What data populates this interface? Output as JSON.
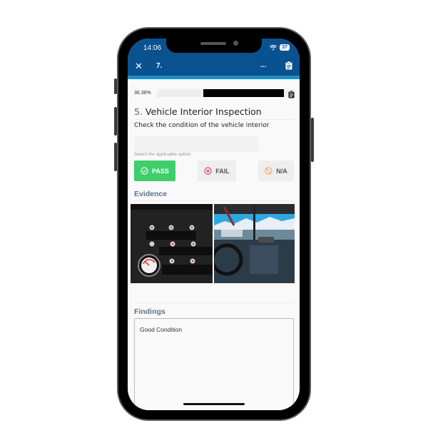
{
  "status_bar": {
    "time": "14:06",
    "battery": "37",
    "wifi_icon": "wifi-icon"
  },
  "header": {
    "close_label": "✕",
    "title": "7.",
    "more_label": "...",
    "clipboard_icon": "clipboard-icon"
  },
  "progress": {
    "percent_label": "36.36%",
    "value": 0.3636
  },
  "question": {
    "number": "5.",
    "title": "Vehicle Interior Inspection",
    "description": "Check the condition of the vehicle interior"
  },
  "options": {
    "hint": "Select the applicable option",
    "selected": "PASS",
    "items": [
      {
        "label": "PASS",
        "icon": "check-circle-icon",
        "color": "#3ecf6b"
      },
      {
        "label": "FAIL",
        "icon": "x-circle-icon",
        "color": "#e5405e"
      },
      {
        "label": "N/A",
        "icon": "ban-icon",
        "color": "#f5a15b"
      }
    ]
  },
  "evidence": {
    "label": "Evidence",
    "photos": [
      {
        "alt": "Dashboard switch panel with gauges"
      },
      {
        "alt": "Truck cab interior with steering wheel and windshield view of mountains"
      }
    ]
  },
  "findings": {
    "label": "Findings",
    "value": "Good Condition"
  },
  "colors": {
    "primary": "#0a5190",
    "accent": "#1a8fc4",
    "pass": "#3ecf6b",
    "section_label": "#5a7590"
  }
}
